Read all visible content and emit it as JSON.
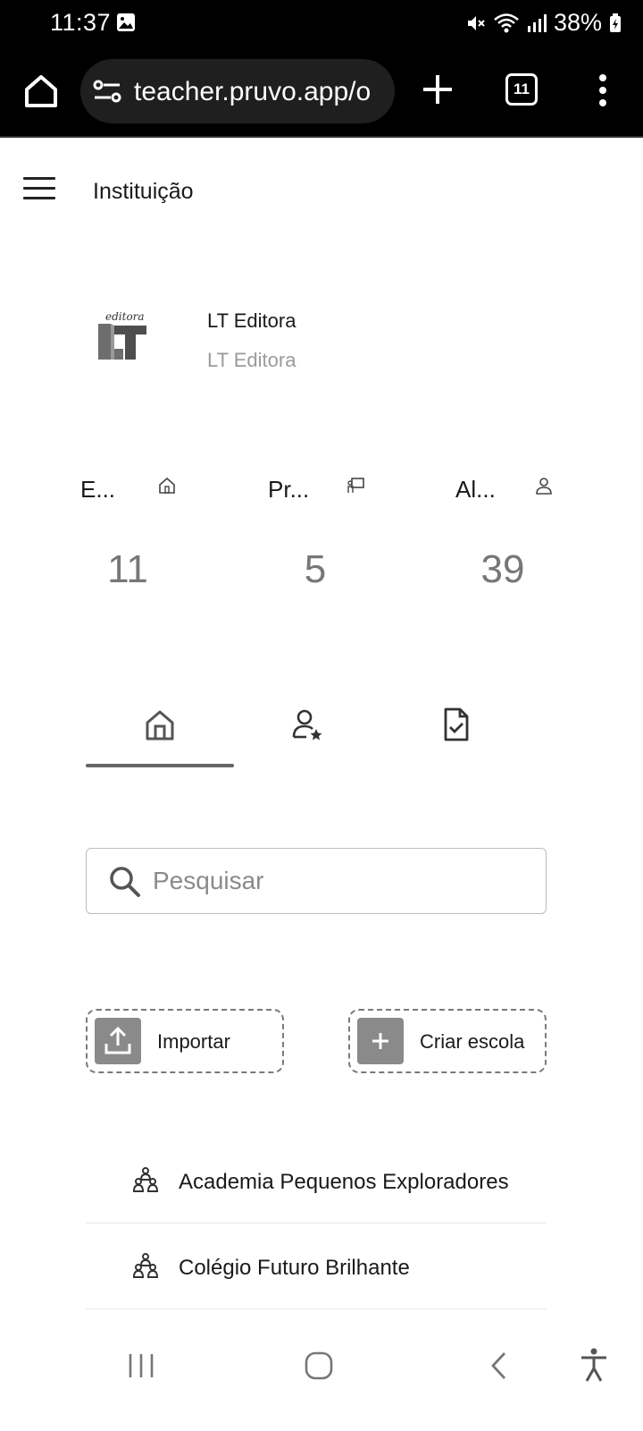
{
  "status_bar": {
    "time": "11:37",
    "battery": "38%",
    "icons": [
      "gallery-icon",
      "mute-icon",
      "wifi-icon",
      "signal-icon",
      "battery-icon"
    ]
  },
  "browser": {
    "url": "teacher.pruvo.app/o",
    "tab_count": "11"
  },
  "header": {
    "title": "Instituição"
  },
  "institution": {
    "name": "LT Editora",
    "subtitle": "LT Editora",
    "logo_text": "editora"
  },
  "stats": [
    {
      "label": "E...",
      "icon": "school-icon",
      "value": "11"
    },
    {
      "label": "Pr...",
      "icon": "teacher-icon",
      "value": "5"
    },
    {
      "label": "Al...",
      "icon": "person-icon",
      "value": "39"
    }
  ],
  "tabs": [
    {
      "icon": "home-icon",
      "active": true
    },
    {
      "icon": "person-star-icon",
      "active": false
    },
    {
      "icon": "document-check-icon",
      "active": false
    }
  ],
  "search": {
    "placeholder": "Pesquisar"
  },
  "actions": {
    "import_label": "Importar",
    "create_label": "Criar escola"
  },
  "schools": [
    {
      "name": "Academia Pequenos Exploradores"
    },
    {
      "name": "Colégio Futuro Brilhante"
    }
  ],
  "colors": {
    "accent_gray": "#8a8a8a",
    "indicator": "#666666",
    "status_bar": "#000000"
  }
}
